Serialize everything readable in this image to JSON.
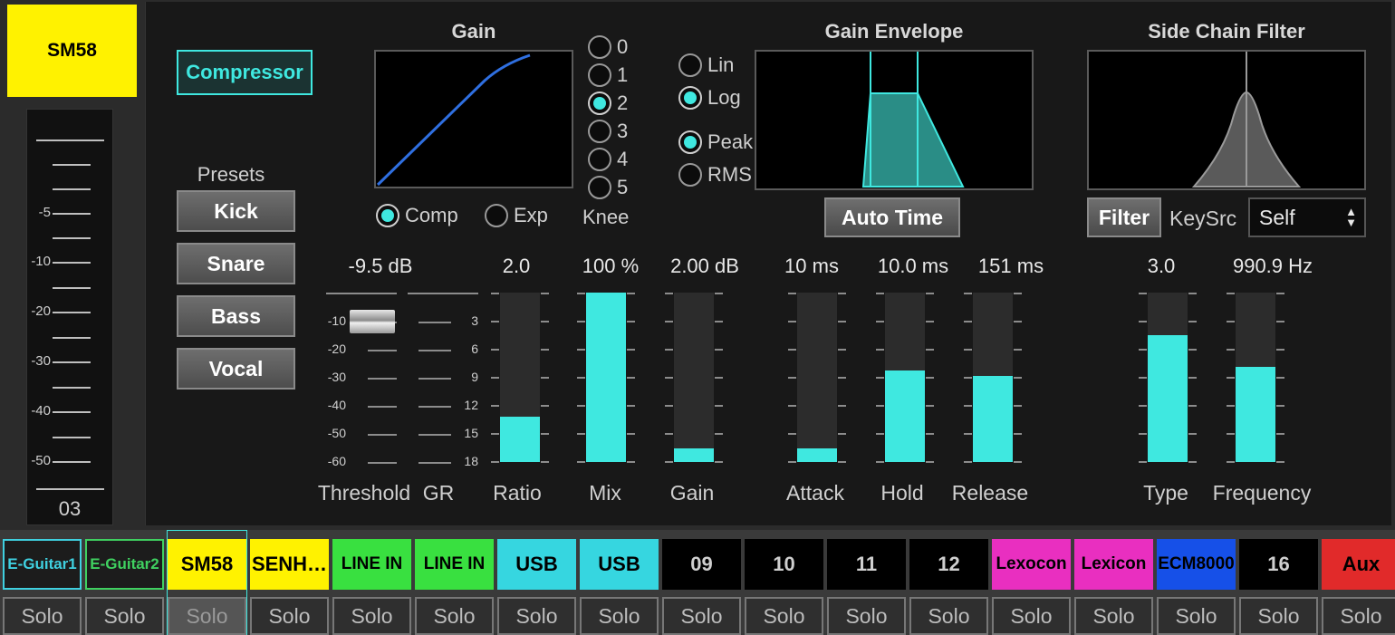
{
  "channel": {
    "name": "SM58",
    "number": "03"
  },
  "left_meter": {
    "labels": [
      "-5",
      "-10",
      "-20",
      "-30",
      "-40",
      "-50"
    ]
  },
  "compressor": {
    "label": "Compressor",
    "enabled": true
  },
  "presets": {
    "label": "Presets",
    "items": [
      "Kick",
      "Snare",
      "Bass",
      "Vocal"
    ]
  },
  "gain": {
    "title": "Gain",
    "modes": [
      "Comp",
      "Exp"
    ],
    "selected_mode": "Comp"
  },
  "knee": {
    "label": "Knee",
    "options": [
      "0",
      "1",
      "2",
      "3",
      "4",
      "5"
    ],
    "selected": "2"
  },
  "envelope": {
    "title": "Gain Envelope",
    "scale_options": [
      "Lin",
      "Log"
    ],
    "scale_selected": "Log",
    "detect_options": [
      "Peak",
      "RMS"
    ],
    "detect_selected": "Peak",
    "auto_time_label": "Auto Time"
  },
  "sidechain": {
    "title": "Side Chain Filter",
    "filter_label": "Filter",
    "keysrc_label": "KeySrc",
    "keysrc_value": "Self"
  },
  "threshold_scale": [
    "-10",
    "-20",
    "-30",
    "-40",
    "-50",
    "-60"
  ],
  "gr_scale": [
    "3",
    "6",
    "9",
    "12",
    "15",
    "18"
  ],
  "params": {
    "threshold": {
      "label": "Threshold",
      "value": "-9.5 dB"
    },
    "gr": {
      "label": "GR"
    },
    "ratio": {
      "label": "Ratio",
      "value": "2.0",
      "level": 0.27
    },
    "mix": {
      "label": "Mix",
      "value": "100 %",
      "level": 1.0
    },
    "gain": {
      "label": "Gain",
      "value": "2.00 dB",
      "level": 0.08
    },
    "attack": {
      "label": "Attack",
      "value": "10 ms",
      "level": 0.08
    },
    "hold": {
      "label": "Hold",
      "value": "10.0 ms",
      "level": 0.54
    },
    "release": {
      "label": "Release",
      "value": "151 ms",
      "level": 0.51
    },
    "type": {
      "label": "Type",
      "value": "3.0",
      "level": 0.75
    },
    "frequency": {
      "label": "Frequency",
      "value": "990.9 Hz",
      "level": 0.56
    }
  },
  "channels": [
    {
      "name": "E-Guitar1",
      "style": "outline",
      "color": "#3fd0e0"
    },
    {
      "name": "E-Guitar2",
      "style": "outline",
      "color": "#3fd060"
    },
    {
      "name": "SM58",
      "style": "fill",
      "color": "#fff200",
      "text": "#000000"
    },
    {
      "name": "SENH…",
      "style": "fill",
      "color": "#fff200",
      "text": "#000000"
    },
    {
      "name": "LINE IN",
      "style": "fill",
      "color": "#39e040",
      "text": "#000000"
    },
    {
      "name": "LINE IN",
      "style": "fill",
      "color": "#39e040",
      "text": "#000000"
    },
    {
      "name": "USB",
      "style": "fill",
      "color": "#36d6e0",
      "text": "#000000"
    },
    {
      "name": "USB",
      "style": "fill",
      "color": "#36d6e0",
      "text": "#000000"
    },
    {
      "name": "09",
      "style": "fill",
      "color": "#000000",
      "text": "#cfcfcf"
    },
    {
      "name": "10",
      "style": "fill",
      "color": "#000000",
      "text": "#cfcfcf"
    },
    {
      "name": "11",
      "style": "fill",
      "color": "#000000",
      "text": "#cfcfcf"
    },
    {
      "name": "12",
      "style": "fill",
      "color": "#000000",
      "text": "#cfcfcf"
    },
    {
      "name": "Lexocon",
      "style": "fill",
      "color": "#e92fc0",
      "text": "#000000"
    },
    {
      "name": "Lexicon",
      "style": "fill",
      "color": "#e92fc0",
      "text": "#000000"
    },
    {
      "name": "ECM8000",
      "style": "fill",
      "color": "#1650e8",
      "text": "#000000"
    },
    {
      "name": "16",
      "style": "fill",
      "color": "#000000",
      "text": "#cfcfcf"
    },
    {
      "name": "Aux",
      "style": "fill",
      "color": "#e12a2a",
      "text": "#000000"
    }
  ],
  "solo_label": "Solo",
  "colors": {
    "accent": "#3fe8e0",
    "curve": "#2f6fe0"
  }
}
